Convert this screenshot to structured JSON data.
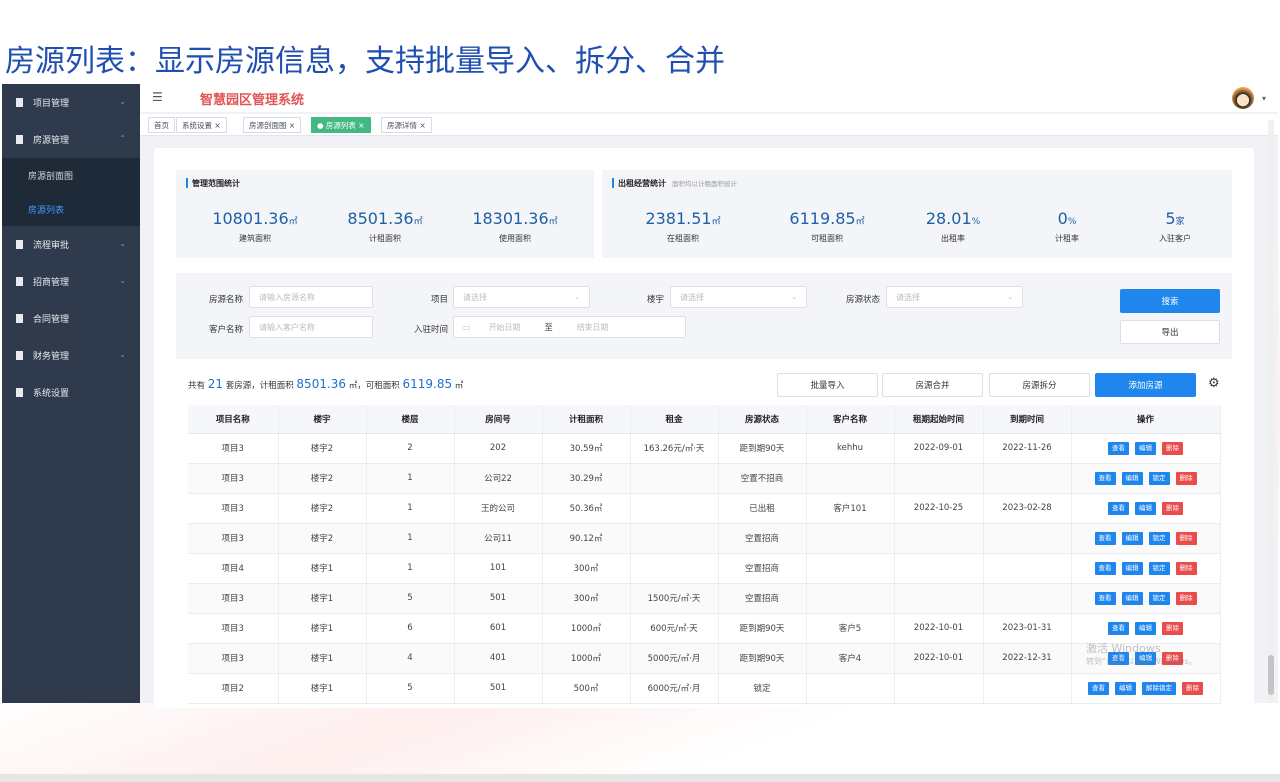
{
  "slide_title": "房源列表：显示房源信息，支持批量导入、拆分、合并",
  "app": {
    "system_title": "智慧园区管理系统",
    "sidebar": {
      "items": [
        {
          "label": "项目管理",
          "chevron": "⌄"
        },
        {
          "label": "房源管理",
          "chevron": "⌃"
        },
        {
          "label": "流程审批",
          "chevron": "⌄"
        },
        {
          "label": "招商管理",
          "chevron": "⌄"
        },
        {
          "label": "合同管理",
          "chevron": ""
        },
        {
          "label": "财务管理",
          "chevron": "⌄"
        },
        {
          "label": "系统设置",
          "chevron": ""
        }
      ],
      "subitems": [
        {
          "label": "房源剖面图"
        },
        {
          "label": "房源列表"
        }
      ]
    },
    "tabs": [
      {
        "label": "首页"
      },
      {
        "label": "系统设置 ×"
      },
      {
        "label": "房源剖面图 ×"
      },
      {
        "label": "● 房源列表 ×"
      },
      {
        "label": "房源详情 ×"
      }
    ],
    "stats_left": {
      "title": "管理范围统计",
      "items": [
        {
          "value": "10801.36",
          "unit": "㎡",
          "label": "建筑面积"
        },
        {
          "value": "8501.36",
          "unit": "㎡",
          "label": "计租面积"
        },
        {
          "value": "18301.36",
          "unit": "㎡",
          "label": "使用面积"
        }
      ]
    },
    "stats_right": {
      "title": "出租经营统计",
      "subtitle": "面积均以计租面积统计",
      "items": [
        {
          "value": "2381.51",
          "unit": "㎡",
          "label": "在租面积"
        },
        {
          "value": "6119.85",
          "unit": "㎡",
          "label": "可租面积"
        },
        {
          "value": "28.01",
          "unit": "%",
          "label": "出租率"
        },
        {
          "value": "0",
          "unit": "%",
          "label": "计租率"
        },
        {
          "value": "5",
          "unit": "家",
          "label": "入驻客户"
        }
      ]
    },
    "filters": {
      "room_name_label": "房源名称",
      "room_name_placeholder": "请输入房源名称",
      "project_label": "项目",
      "project_placeholder": "请选择",
      "building_label": "楼宇",
      "building_placeholder": "请选择",
      "status_label": "房源状态",
      "status_placeholder": "请选择",
      "customer_label": "客户名称",
      "customer_placeholder": "请输入客户名称",
      "checkin_label": "入驻时间",
      "start_placeholder": "开始日期",
      "range_sep": "至",
      "end_placeholder": "结束日期",
      "search_button": "搜索",
      "export_button": "导出"
    },
    "summary": {
      "prefix": "共有",
      "count": "21",
      "mid1": "套房源，计租面积",
      "rent_area": "8501.36",
      "mid2": "㎡，可租面积",
      "avail_area": "6119.85",
      "suffix": "㎡"
    },
    "actions": {
      "batch_import": "批量导入",
      "merge": "房源合并",
      "split": "房源拆分",
      "add": "添加房源"
    },
    "table": {
      "columns": [
        "项目名称",
        "楼宇",
        "楼层",
        "房间号",
        "计租面积",
        "租金",
        "房源状态",
        "客户名称",
        "租期起始时间",
        "到期时间",
        "操作"
      ],
      "rows": [
        {
          "cells": [
            "项目3",
            "楼宇2",
            "2",
            "202",
            "30.59㎡",
            "163.26元/㎡·天",
            "距到期90天",
            "kehhu",
            "2022-09-01",
            "2022-11-26"
          ],
          "ops": [
            "查看",
            "编辑",
            "删除"
          ]
        },
        {
          "cells": [
            "项目3",
            "楼宇2",
            "1",
            "公司22",
            "30.29㎡",
            "",
            "空置不招商",
            "",
            "",
            ""
          ],
          "ops": [
            "查看",
            "编辑",
            "锁定",
            "删除"
          ]
        },
        {
          "cells": [
            "项目3",
            "楼宇2",
            "1",
            "王的公司",
            "50.36㎡",
            "",
            "已出租",
            "客户101",
            "2022-10-25",
            "2023-02-28"
          ],
          "ops": [
            "查看",
            "编辑",
            "删除"
          ]
        },
        {
          "cells": [
            "项目3",
            "楼宇2",
            "1",
            "公司11",
            "90.12㎡",
            "",
            "空置招商",
            "",
            "",
            ""
          ],
          "ops": [
            "查看",
            "编辑",
            "锁定",
            "删除"
          ]
        },
        {
          "cells": [
            "项目4",
            "楼宇1",
            "1",
            "101",
            "300㎡",
            "",
            "空置招商",
            "",
            "",
            ""
          ],
          "ops": [
            "查看",
            "编辑",
            "锁定",
            "删除"
          ]
        },
        {
          "cells": [
            "项目3",
            "楼宇1",
            "5",
            "501",
            "300㎡",
            "1500元/㎡·天",
            "空置招商",
            "",
            "",
            ""
          ],
          "ops": [
            "查看",
            "编辑",
            "锁定",
            "删除"
          ]
        },
        {
          "cells": [
            "项目3",
            "楼宇1",
            "6",
            "601",
            "1000㎡",
            "600元/㎡·天",
            "距到期90天",
            "客户5",
            "2022-10-01",
            "2023-01-31"
          ],
          "ops": [
            "查看",
            "编辑",
            "删除"
          ]
        },
        {
          "cells": [
            "项目3",
            "楼宇1",
            "4",
            "401",
            "1000㎡",
            "5000元/㎡·月",
            "距到期90天",
            "客户4",
            "2022-10-01",
            "2022-12-31"
          ],
          "ops": [
            "查看",
            "编辑",
            "删除"
          ]
        },
        {
          "cells": [
            "项目2",
            "楼宇1",
            "5",
            "501",
            "500㎡",
            "6000元/㎡·月",
            "锁定",
            "",
            "",
            ""
          ],
          "ops": [
            "查看",
            "编辑",
            "解除锁定",
            "删除"
          ]
        }
      ]
    },
    "watermark": {
      "line1": "激活 Windows",
      "line2": "转到“设置”以激活 Windows。"
    }
  },
  "colors": {
    "sidebar_bg": "#2f3b4d",
    "brand_title": "#e05656",
    "primary": "#1f86ee",
    "danger": "#ea4b4b",
    "active_tab": "#42b983",
    "slide_title": "#1f4fb0"
  }
}
